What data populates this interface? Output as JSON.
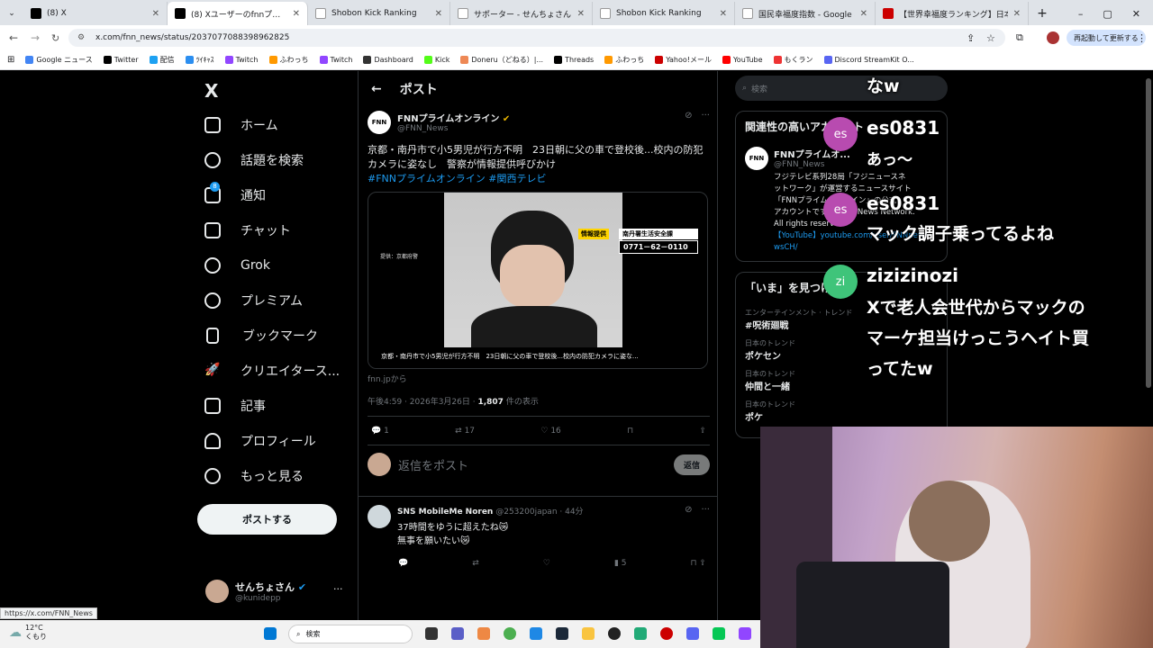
{
  "tabs": [
    {
      "label": "(8) X",
      "active": false
    },
    {
      "label": "(8) Xユーザーのfnnプライムオンライン",
      "active": true
    },
    {
      "label": "Shobon Kick Ranking",
      "active": false
    },
    {
      "label": "サポーター - せんちょさん (@kunidepp",
      "active": false
    },
    {
      "label": "Shobon Kick Ranking",
      "active": false
    },
    {
      "label": "国民幸福度指数 - Google 検索",
      "active": false
    },
    {
      "label": "【世界幸福度ランキング】日本の幸福",
      "active": false
    }
  ],
  "address": {
    "url": "x.com/fnn_news/status/2037077088398962825",
    "profile_button": "再起動して更新する"
  },
  "bookmarks": [
    "Google ニュース",
    "Twitter",
    "配信",
    "ﾂｲｷｬｽ",
    "Twitch",
    "ふわっち",
    "Twitch",
    "Dashboard",
    "Kick",
    "Doneru（どねる）|...",
    "Threads",
    "ふわっち",
    "Yahoo!メール",
    "YouTube",
    "もくラン",
    "Discord StreamKit O..."
  ],
  "nav": {
    "items": [
      "ホーム",
      "話題を検索",
      "通知",
      "チャット",
      "Grok",
      "プレミアム",
      "ブックマーク",
      "クリエイタース...",
      "記事",
      "プロフィール",
      "もっと見る"
    ],
    "notification_badge": "8",
    "post_button": "ポストする",
    "user_name": "せんちょさん",
    "user_handle": "@kunidepp"
  },
  "header": {
    "title": "ポスト"
  },
  "tweet": {
    "name": "FNNプライムオンライン",
    "handle": "@FNN_News",
    "text": "京都・南丹市で小5男児が行方不明　23日朝に父の車で登校後...校内の防犯カメラに姿なし　警察が情報提供呼びかけ",
    "hashtags": "#FNNプライムオンライン #関西テレビ",
    "media_label_left": "提供：京都府警",
    "media_tag": "情報提供",
    "media_police": "南丹署生活安全課",
    "media_phone": "0771－62－0110",
    "media_caption": "京都・南丹市で小5男児が行方不明　23日朝に父の車で登校後...校内の防犯カメラに姿な...",
    "source": "fnn.jpから",
    "time": "午後4:59 · 2026年3月26日 · ",
    "views": "1,807",
    "views_label": "件の表示",
    "replies": "1",
    "retweets": "17",
    "likes": "16"
  },
  "reply_box": {
    "placeholder": "返信をポスト",
    "button": "返信"
  },
  "reply": {
    "name": "SNS MobileMe Noren",
    "handle": "@253200japan · 44分",
    "line1": "37時間をゆうに超えたね😿",
    "line2": "無事を願いたい😿",
    "views": "5"
  },
  "right": {
    "search_placeholder": "検索",
    "related_title": "関連性の高いアカウント",
    "related_name": "FNNプライムオ...",
    "related_handle": "@FNN_News",
    "related_bio1": "フジテレビ系列28局「フジニュースネ",
    "related_bio2": "ットワーク」が運営するニュースサイト",
    "related_bio3": "「FNNプライムオンライン」の公式",
    "related_bio4": "アカウントです。©Fuji News Network.",
    "related_bio5": "All rights reserved.",
    "related_bio6": "【YouTube】youtube.com/user/FNNnews",
    "related_bio7": "wsCH/",
    "now_title": "「いま」を見つけよう",
    "trends": [
      {
        "cat": "エンターテインメント · トレンド",
        "name": "#呪術廻戦"
      },
      {
        "cat": "日本のトレンド",
        "name": "ポケセン"
      },
      {
        "cat": "日本のトレンド",
        "name": "仲間と一緒"
      },
      {
        "cat": "日本のトレンド",
        "name": "ポケ"
      }
    ]
  },
  "chat": {
    "top_line": "なw",
    "m1_initial": "es",
    "m1_name": "es0831",
    "m1_text": "あっ～",
    "m2_initial": "es",
    "m2_name": "es0831",
    "m2_text": "マック調子乗ってるよね",
    "m3_initial": "zi",
    "m3_name": "zizizinozi",
    "m3_line1": "Xで老人会世代からマックの",
    "m3_line2": "マーケ担当けっこうヘイト買",
    "m3_line3": "ってたw",
    "m1_color": "#b84bb0",
    "m3_color": "#3fc47a"
  },
  "statusbar": {
    "url": "https://x.com/FNN_News"
  },
  "taskbar": {
    "temp": "12°C",
    "weather": "くもり",
    "search": "検索"
  }
}
